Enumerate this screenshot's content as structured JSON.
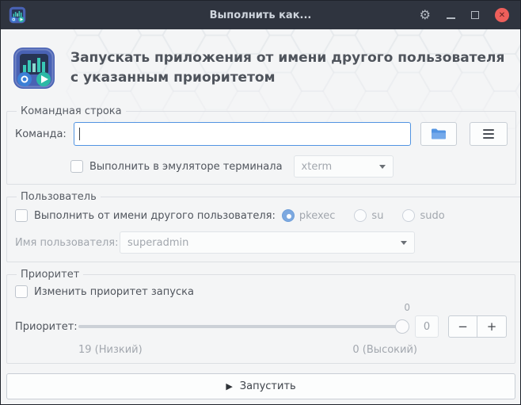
{
  "window": {
    "title": "Выполнить как...",
    "icons": {
      "gear": "⚙",
      "close": "✕",
      "play": "▶"
    }
  },
  "header": {
    "title": "Запускать приложения от имени другого пользователя с указанным приоритетом"
  },
  "command_section": {
    "legend": "Командная строка",
    "command_label": "Команда:",
    "command_value": "",
    "terminal_checkbox_label": "Выполнить в эмуляторе терминала",
    "terminal_select_value": "xterm"
  },
  "user_section": {
    "legend": "Пользователь",
    "checkbox_label": "Выполнить от имени другого пользователя:",
    "radios": [
      {
        "label": "pkexec",
        "selected": true
      },
      {
        "label": "su",
        "selected": false
      },
      {
        "label": "sudo",
        "selected": false
      }
    ],
    "username_label": "Имя пользователя:",
    "username_value": "superadmin"
  },
  "priority_section": {
    "legend": "Приоритет",
    "checkbox_label": "Изменить приоритет запуска",
    "slider_value_label": "0",
    "priority_label": "Приоритет:",
    "spin_value": "0",
    "minus_label": "−",
    "plus_label": "+",
    "min_label": "19 (Низкий)",
    "max_label": "0 (Высокий)"
  },
  "run_button": {
    "label": "Запустить"
  },
  "colors": {
    "accent": "#5294e2",
    "titlebar_bg": "#2f343f",
    "close_button": "#ee5f5b",
    "body_bg": "#f4f5f6",
    "icon_teal": "#2cb9a6",
    "icon_blue": "#4962b4"
  }
}
